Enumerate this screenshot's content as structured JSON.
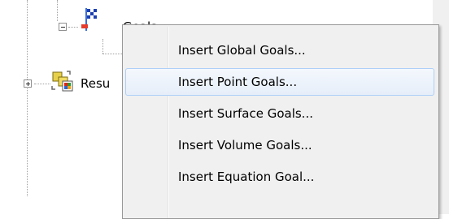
{
  "tree": {
    "goals_label": "Goals",
    "results_label": "Resu"
  },
  "context_menu": {
    "items": [
      {
        "label": "Insert Global Goals...",
        "highlighted": false
      },
      {
        "label": "Insert Point Goals...",
        "highlighted": true
      },
      {
        "label": "Insert Surface Goals...",
        "highlighted": false
      },
      {
        "label": "Insert Volume Goals...",
        "highlighted": false
      },
      {
        "label": "Insert Equation Goal...",
        "highlighted": false
      }
    ]
  },
  "colors": {
    "menu_background": "#f0f0f0",
    "menu_border": "#979797",
    "highlight_border": "#aecff7",
    "highlight_fill": "#e6eef9"
  }
}
